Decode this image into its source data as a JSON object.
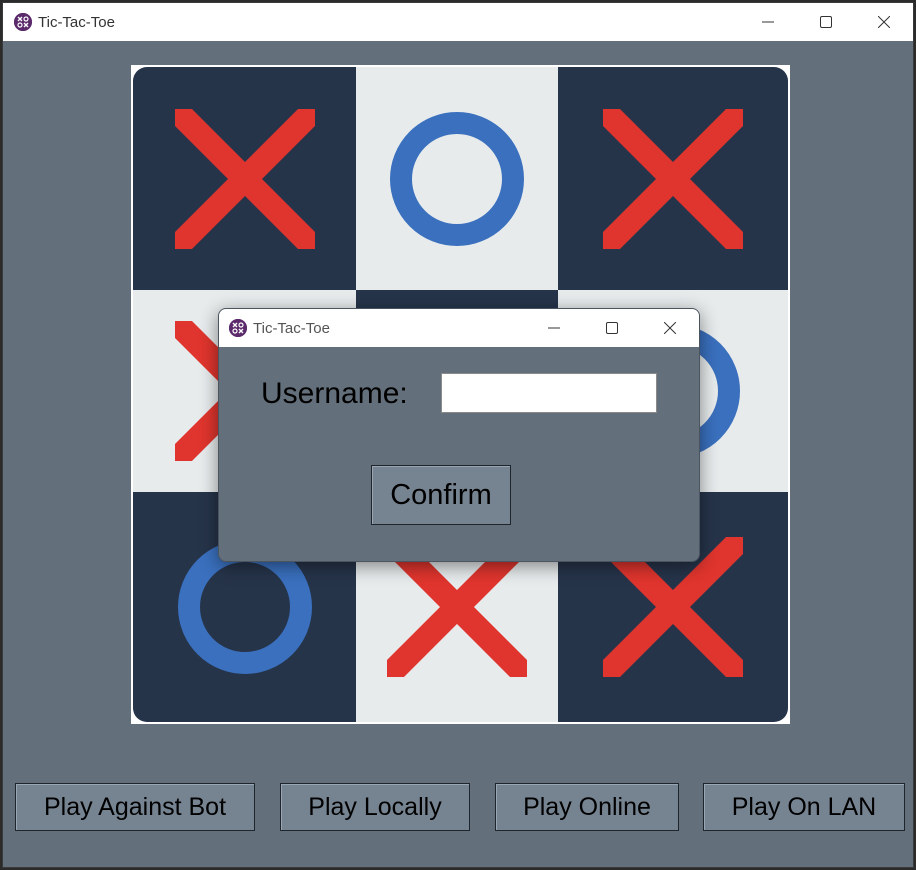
{
  "window": {
    "title": "Tic-Tac-Toe",
    "icon": "tictactoe-app-icon",
    "controls": [
      "minimize-icon",
      "maximize-icon",
      "close-icon"
    ]
  },
  "board": {
    "cells": [
      {
        "mark": "X",
        "shade": "dark"
      },
      {
        "mark": "O",
        "shade": "light"
      },
      {
        "mark": "X",
        "shade": "dark"
      },
      {
        "mark": "X",
        "shade": "light"
      },
      {
        "mark": "",
        "shade": "dark"
      },
      {
        "mark": "O",
        "shade": "light"
      },
      {
        "mark": "O",
        "shade": "dark"
      },
      {
        "mark": "X",
        "shade": "light"
      },
      {
        "mark": "X",
        "shade": "dark"
      }
    ],
    "colors": {
      "x": "#e0352e",
      "o": "#3a70be",
      "dark": "#26344a",
      "light": "#e7ebec"
    }
  },
  "menu": {
    "play_bot": "Play Against Bot",
    "play_local": "Play Locally",
    "play_online": "Play Online",
    "play_lan": "Play On LAN"
  },
  "dialog": {
    "title": "Tic-Tac-Toe",
    "username_label": "Username:",
    "username_value": "",
    "confirm_label": "Confirm"
  }
}
